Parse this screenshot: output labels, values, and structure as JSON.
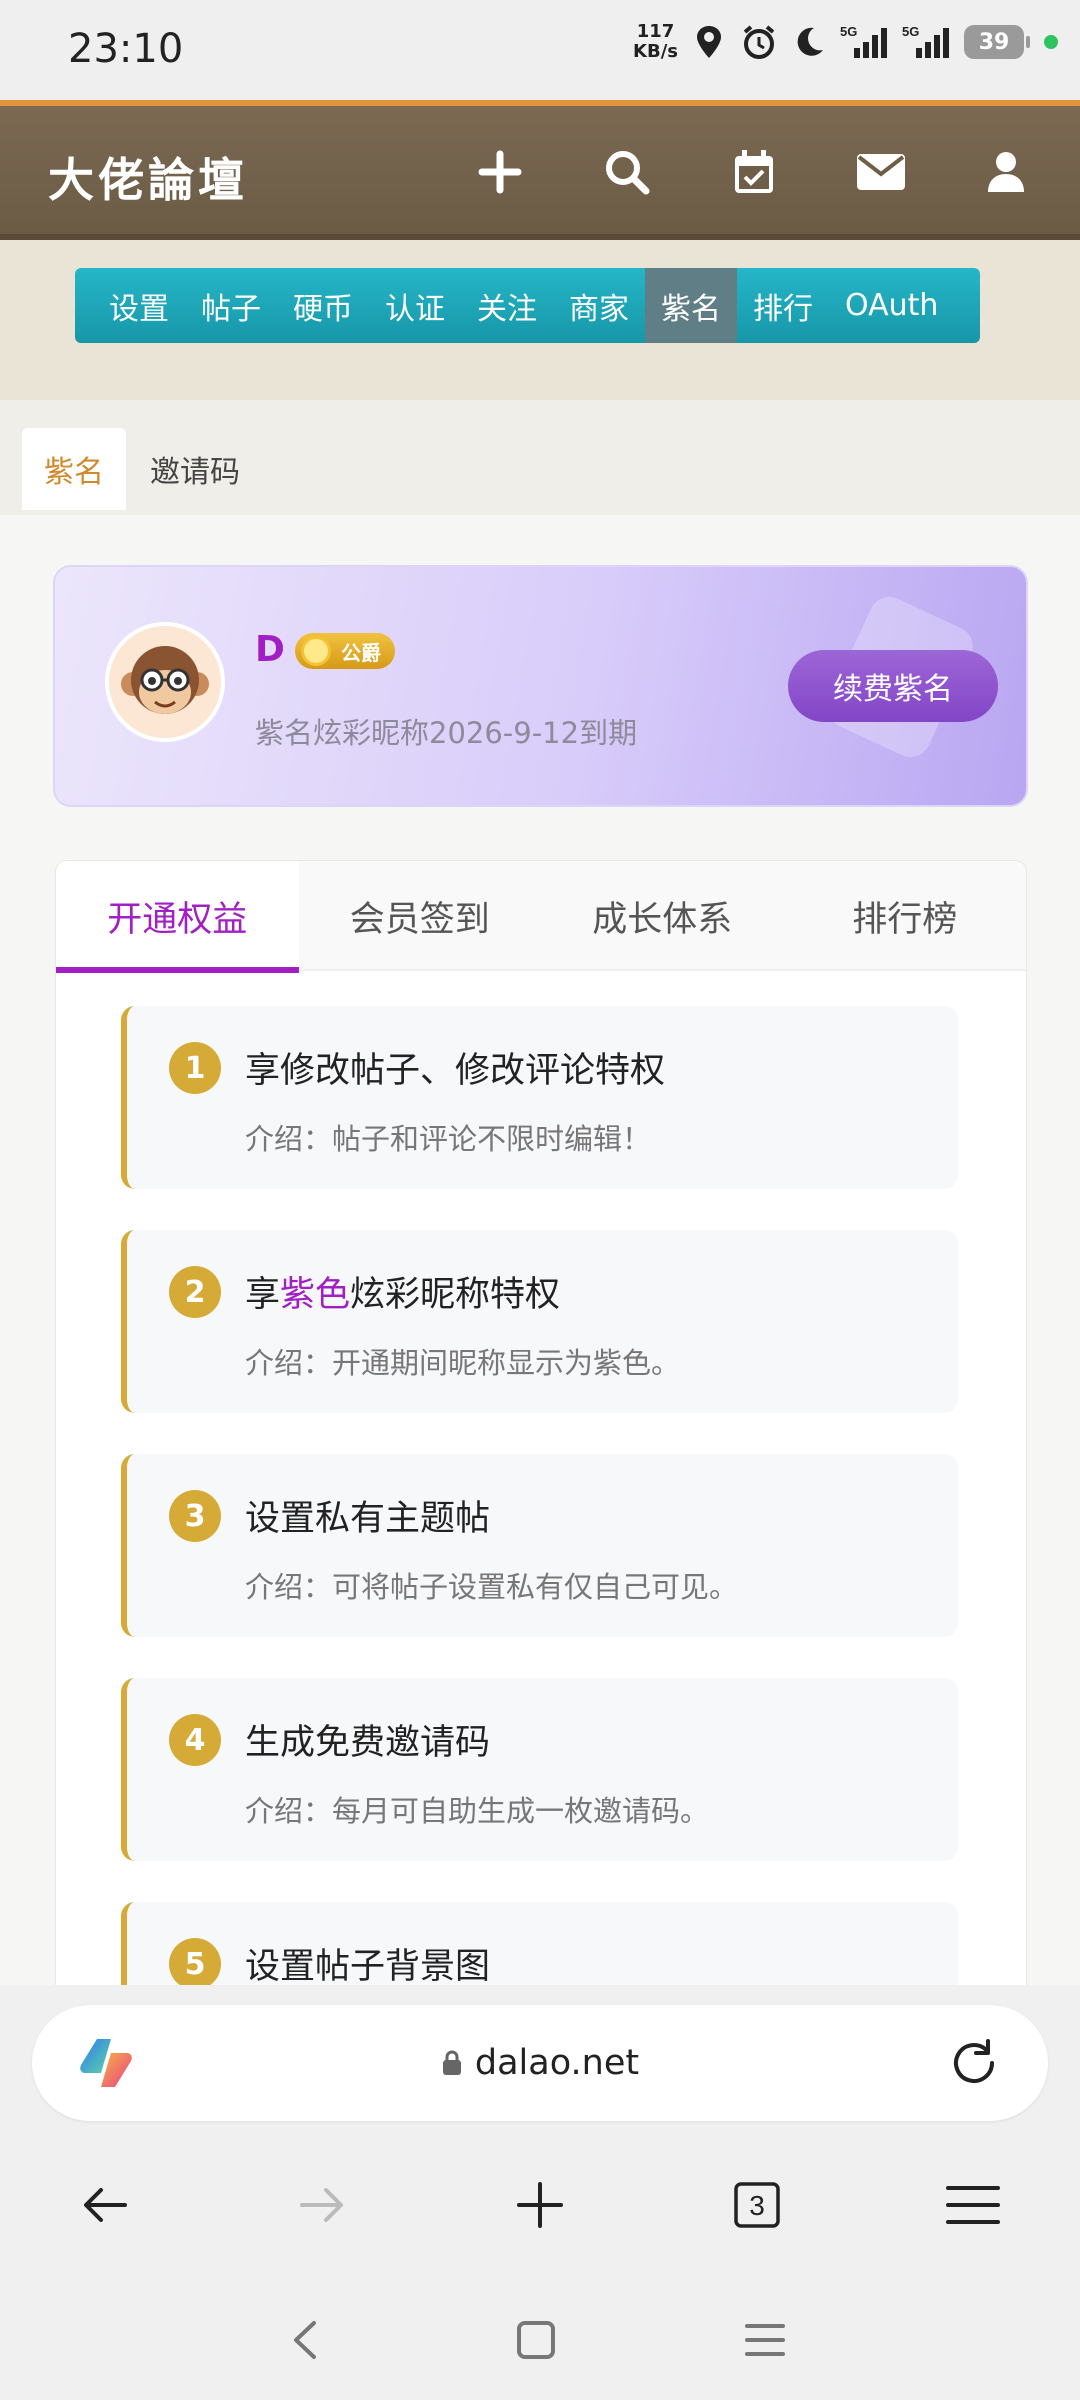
{
  "status_bar": {
    "time": "23:10",
    "net_speed_value": "117",
    "net_speed_unit": "KB/s",
    "signal1": "5G",
    "signal2": "5G",
    "battery": "39"
  },
  "header": {
    "logo": "大佬論壇",
    "icons": [
      "plus-icon",
      "search-icon",
      "calendar-check-icon",
      "mail-icon",
      "user-icon"
    ]
  },
  "menu": {
    "items": [
      "设置",
      "帖子",
      "硬币",
      "认证",
      "关注",
      "商家",
      "紫名",
      "排行",
      "OAuth"
    ],
    "active": "紫名"
  },
  "subtabs": {
    "items": [
      "紫名",
      "邀请码"
    ]
  },
  "vip_card": {
    "username": "D",
    "badge": "公爵",
    "expiry": "紫名炫彩昵称2026-9-12到期",
    "renew_button": "续费紫名"
  },
  "panel_tabs": [
    "开通权益",
    "会员签到",
    "成长体系",
    "排行榜"
  ],
  "benefits": [
    {
      "num": "1",
      "title": "享修改帖子、修改评论特权",
      "desc": "介绍：帖子和评论不限时编辑！"
    },
    {
      "num": "2",
      "title_pre": "享",
      "title_highlight": "紫色",
      "title_post": "炫彩昵称特权",
      "desc": "介绍：开通期间昵称显示为紫色。"
    },
    {
      "num": "3",
      "title": "设置私有主题帖",
      "desc": "介绍：可将帖子设置私有仅自己可见。"
    },
    {
      "num": "4",
      "title": "生成免费邀请码",
      "desc": "介绍：每月可自助生成一枚邀请码。"
    },
    {
      "num": "5",
      "title": "设置帖子背景图",
      "desc": ""
    }
  ],
  "browser": {
    "url": "dalao.net",
    "tab_count": "3"
  },
  "colors": {
    "accent_purple": "#a21fc4",
    "menu_teal": "#1fa9bb",
    "gold": "#d6aa37",
    "header_brown": "#6f5e48"
  }
}
